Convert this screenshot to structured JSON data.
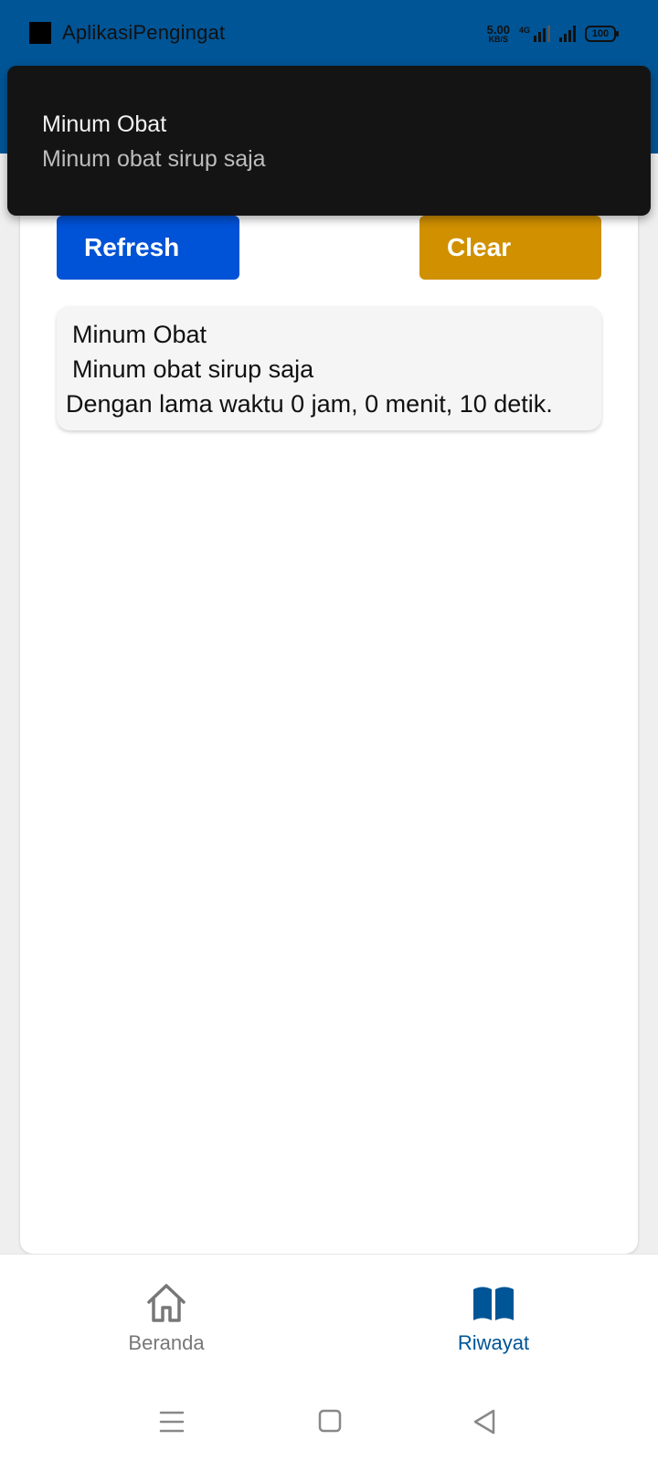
{
  "status_bar": {
    "app_name": "AplikasiPengingat",
    "net_speed_value": "5.00",
    "net_speed_unit": "KB/S",
    "network_label": "4G",
    "battery": "100"
  },
  "toast": {
    "title": "Minum Obat",
    "body": "Minum obat sirup saja"
  },
  "actions": {
    "refresh_label": "Refresh",
    "clear_label": "Clear"
  },
  "history": [
    {
      "title": "Minum Obat",
      "description": "Minum obat sirup saja",
      "duration": "Dengan lama waktu 0 jam, 0 menit, 10 detik."
    }
  ],
  "bottom_nav": {
    "items": [
      {
        "label": "Beranda",
        "icon": "home-icon",
        "active": false
      },
      {
        "label": "Riwayat",
        "icon": "book-icon",
        "active": true
      }
    ]
  },
  "colors": {
    "primary": "#005596",
    "refresh": "#0052d6",
    "clear": "#d09000",
    "toast_bg": "#141414"
  }
}
